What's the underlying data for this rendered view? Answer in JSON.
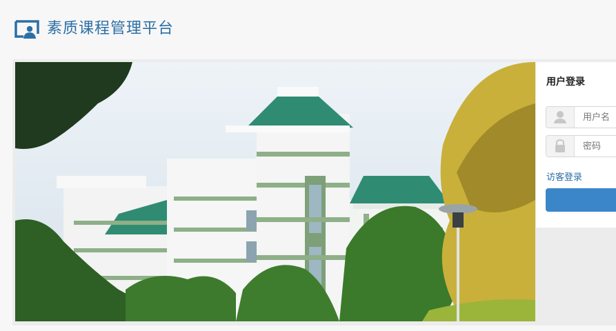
{
  "header": {
    "title": "素质课程管理平台",
    "logo_icon": "presentation-user-icon",
    "title_color": "#2b6fa6"
  },
  "hero": {
    "image": "campus-building-photo"
  },
  "login": {
    "title": "用户登录",
    "username_placeholder": "用户名",
    "username_icon": "user-icon",
    "password_placeholder": "密码",
    "password_icon": "lock-icon",
    "guest_link": "访客登录",
    "submit_label": "",
    "accent_color": "#3b86c9"
  }
}
